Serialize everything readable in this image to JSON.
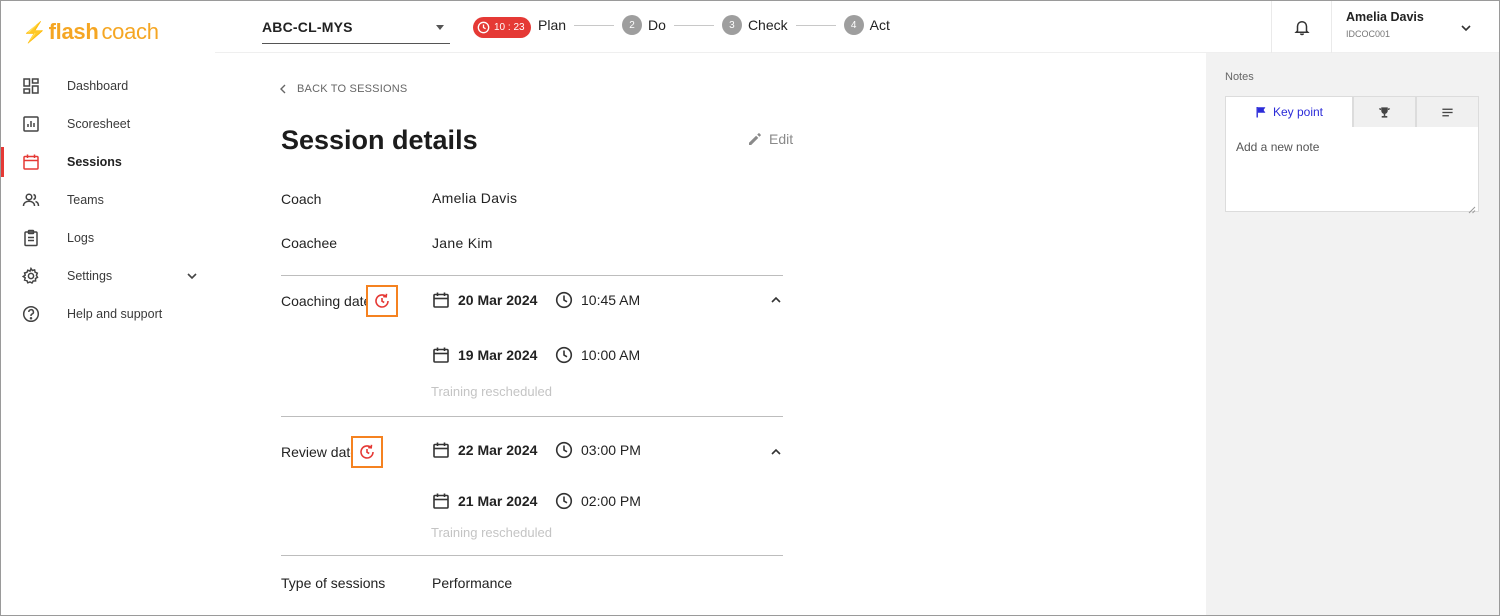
{
  "brand": {
    "name_flash": "flash",
    "name_coach": "coach",
    "accent": "#f5a623"
  },
  "sidebar": {
    "items": [
      {
        "label": "Dashboard",
        "icon": "dashboard-icon"
      },
      {
        "label": "Scoresheet",
        "icon": "scoresheet-icon"
      },
      {
        "label": "Sessions",
        "icon": "calendar-icon",
        "active": true
      },
      {
        "label": "Teams",
        "icon": "people-icon"
      },
      {
        "label": "Logs",
        "icon": "clipboard-icon"
      },
      {
        "label": "Settings",
        "icon": "gear-icon",
        "expandable": true
      },
      {
        "label": "Help and support",
        "icon": "help-icon"
      }
    ]
  },
  "topbar": {
    "team": "ABC-CL-MYS",
    "timer": "10 : 23",
    "steps": [
      {
        "num": "",
        "label": "Plan"
      },
      {
        "num": "2",
        "label": "Do"
      },
      {
        "num": "3",
        "label": "Check"
      },
      {
        "num": "4",
        "label": "Act"
      }
    ],
    "user_name": "Amelia Davis",
    "user_id": "IDCOC001"
  },
  "main": {
    "back_label": "BACK TO SESSIONS",
    "title": "Session details",
    "edit_label": "Edit",
    "coach_label": "Coach",
    "coach_value": "Amelia Davis",
    "coachee_label": "Coachee",
    "coachee_value": "Jane Kim",
    "coaching_date_label": "Coaching date",
    "coaching_current": {
      "date": "20 Mar 2024",
      "time": "10:45 AM"
    },
    "coaching_previous": {
      "date": "19 Mar 2024",
      "time": "10:00 AM"
    },
    "coaching_note": "Training rescheduled",
    "review_date_label": "Review date",
    "review_current": {
      "date": "22 Mar 2024",
      "time": "03:00 PM"
    },
    "review_previous": {
      "date": "21 Mar 2024",
      "time": "02:00 PM"
    },
    "review_note": "Training rescheduled",
    "type_label": "Type of sessions",
    "type_value": "Performance"
  },
  "notes": {
    "title": "Notes",
    "tab_keypoint": "Key point",
    "placeholder": "Add a new note"
  },
  "colors": {
    "danger": "#e53935",
    "highlight": "#f58220",
    "link": "#2b2bd8"
  }
}
